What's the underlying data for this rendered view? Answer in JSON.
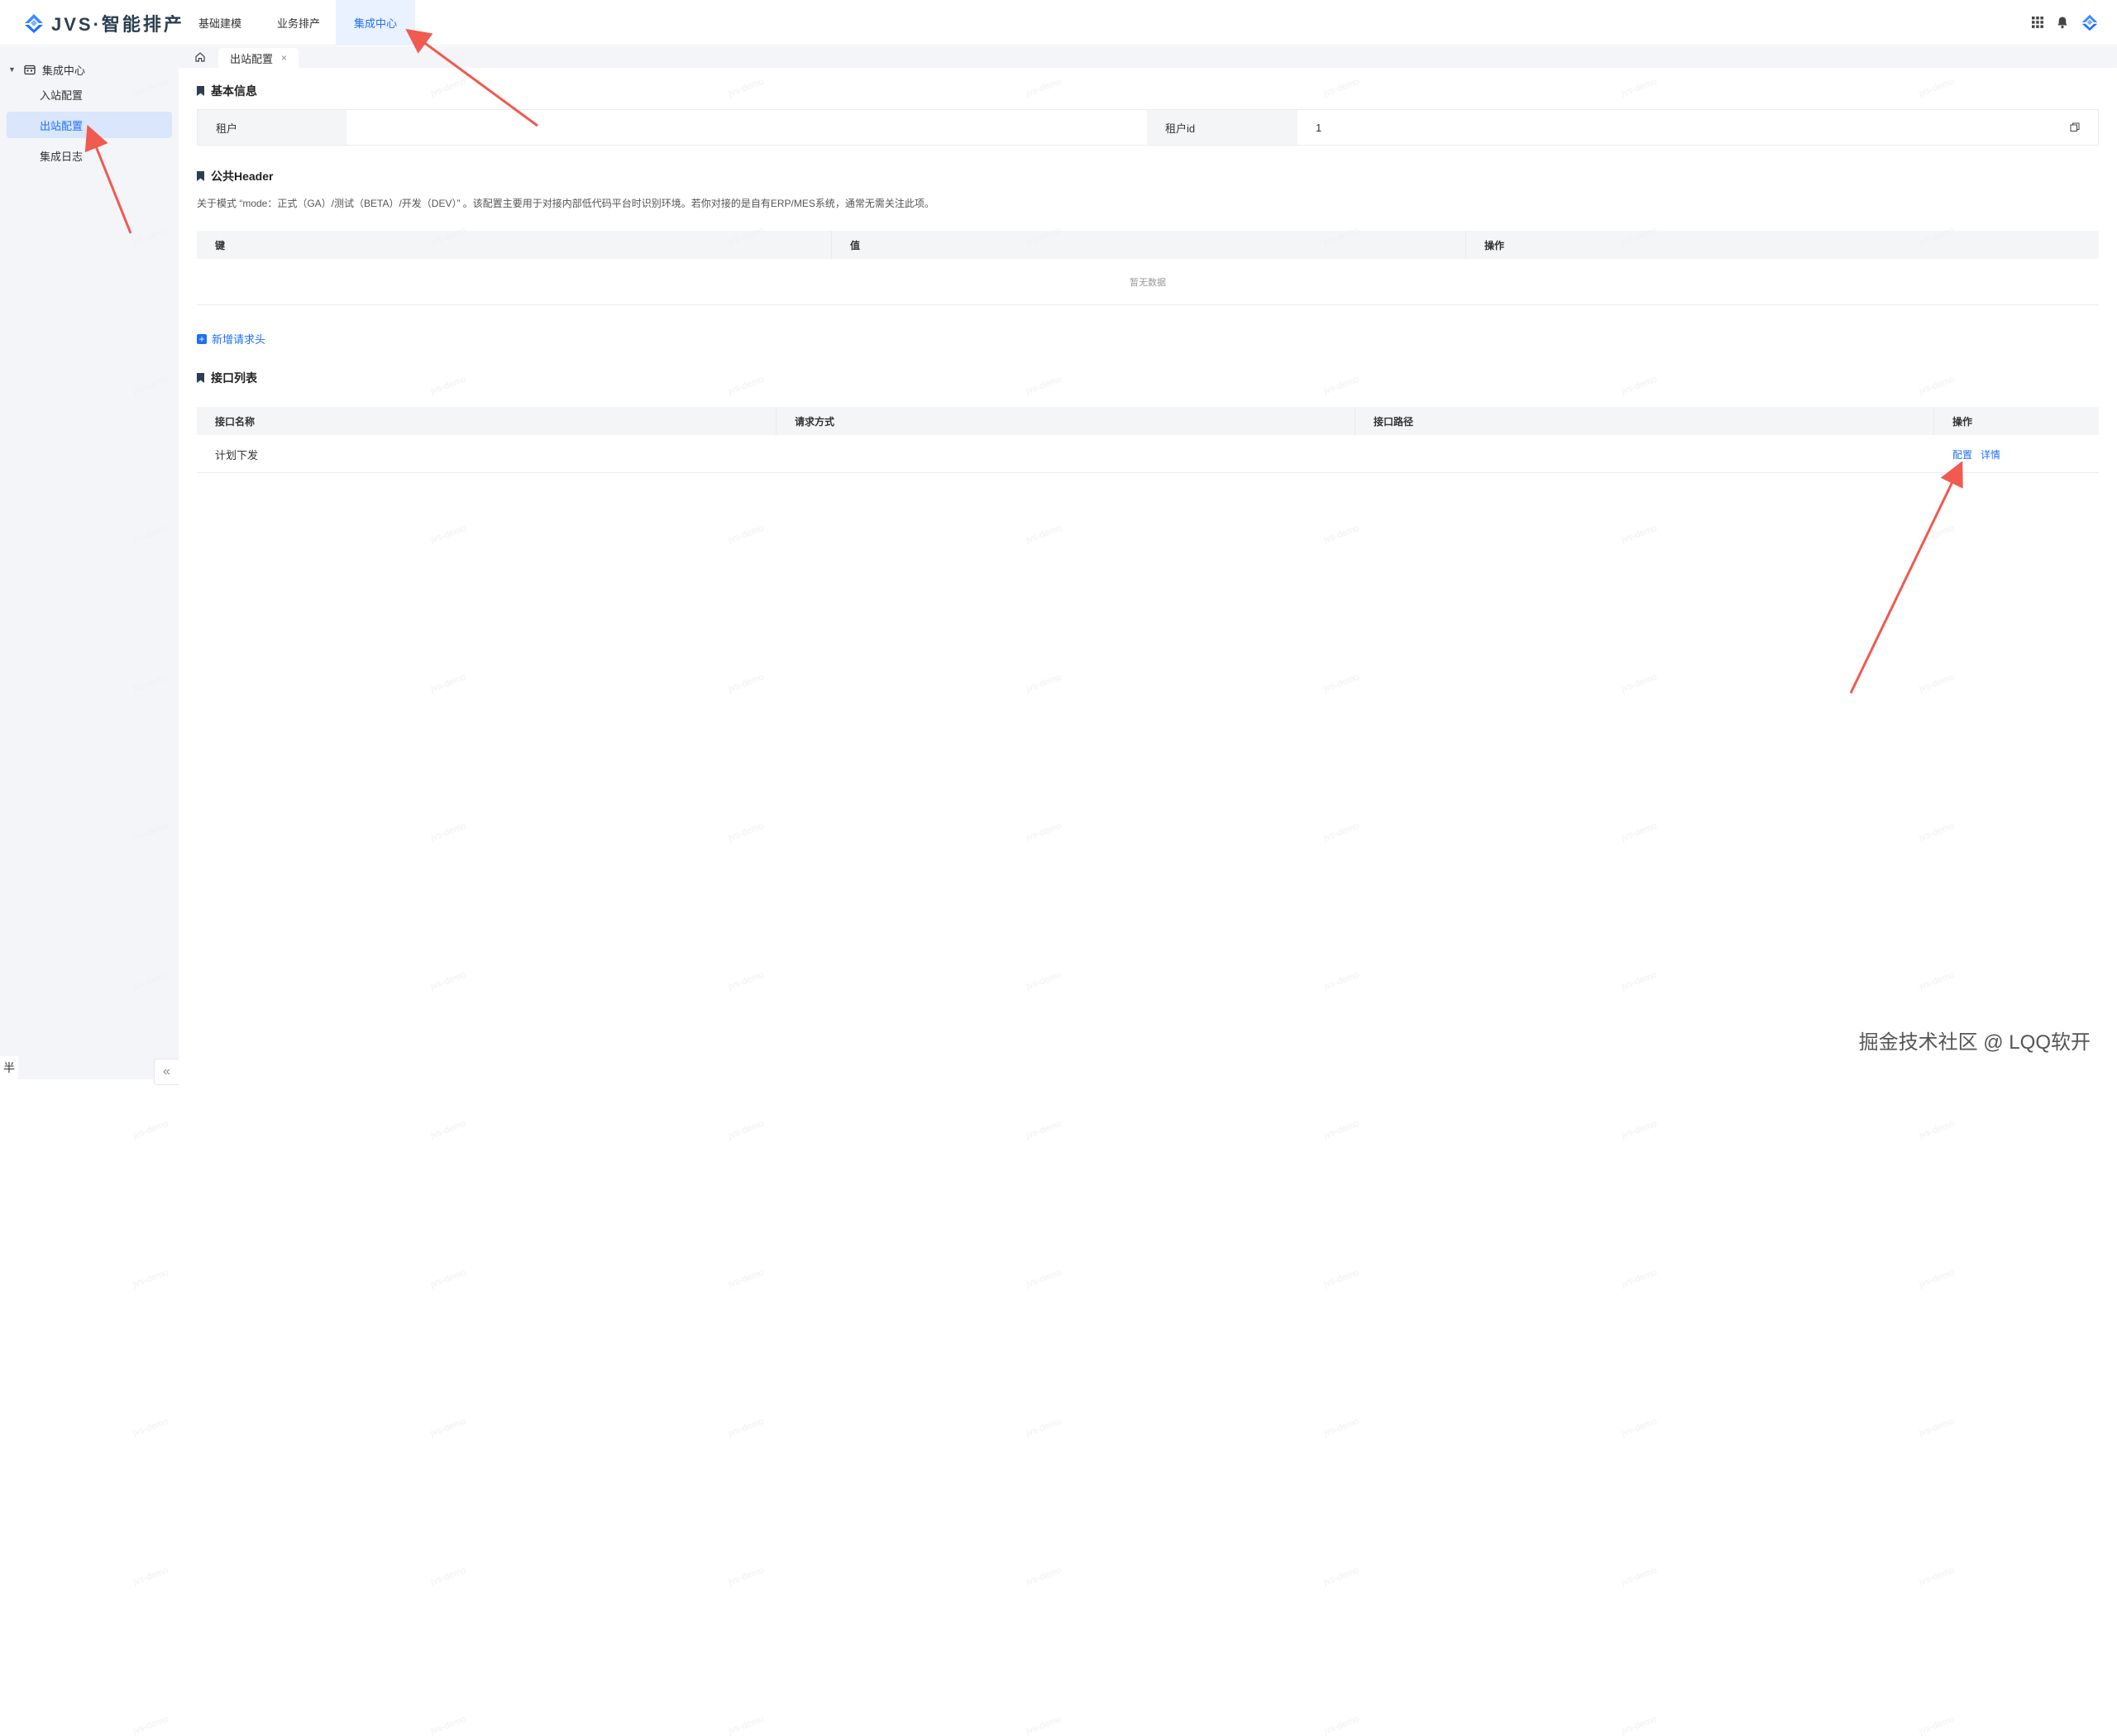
{
  "app": {
    "title": "JVS·智能排产"
  },
  "top_nav": [
    {
      "label": "基础建模",
      "active": false
    },
    {
      "label": "业务排产",
      "active": false
    },
    {
      "label": "集成中心",
      "active": true
    }
  ],
  "top_right_icons": [
    "grid-apps-icon",
    "bell-icon",
    "brand-logo-icon"
  ],
  "sidebar": {
    "group": "集成中心",
    "items": [
      {
        "label": "入站配置",
        "selected": false
      },
      {
        "label": "出站配置",
        "selected": true
      },
      {
        "label": "集成日志",
        "selected": false
      }
    ],
    "collapse_glyph": "«"
  },
  "tabs": {
    "home_icon": "home-icon",
    "open_tab": "出站配置",
    "close_glyph": "×"
  },
  "basic_info": {
    "title": "基本信息",
    "tenant_label": "租户",
    "tenant_value": "",
    "tenant_id_label": "租户id",
    "tenant_id_value": "1"
  },
  "public_header": {
    "title": "公共Header",
    "description": "关于模式 “mode：正式（GA）/测试（BETA）/开发（DEV）” 。该配置主要用于对接内部低代码平台时识别环境。若你对接的是自有ERP/MES系统，通常无需关注此项。",
    "columns": [
      "键",
      "值",
      "操作"
    ],
    "empty_text": "暂无数据",
    "add_button": "新增请求头"
  },
  "api_list": {
    "title": "接口列表",
    "columns": [
      "接口名称",
      "请求方式",
      "接口路径",
      "操作"
    ],
    "rows": [
      {
        "name": "计划下发",
        "method": "",
        "path": "",
        "actions": [
          "配置",
          "详情"
        ]
      }
    ]
  },
  "watermark_text": "jvs-demo",
  "footer_watermark": "掘金技术社区 @ LQQ软开",
  "corner_char": "半",
  "colors": {
    "accent": "#1e6fff",
    "sidebar_bg": "#f4f5f8",
    "selected_bg": "#d9e6fc",
    "arrow": "#f05a4f"
  }
}
